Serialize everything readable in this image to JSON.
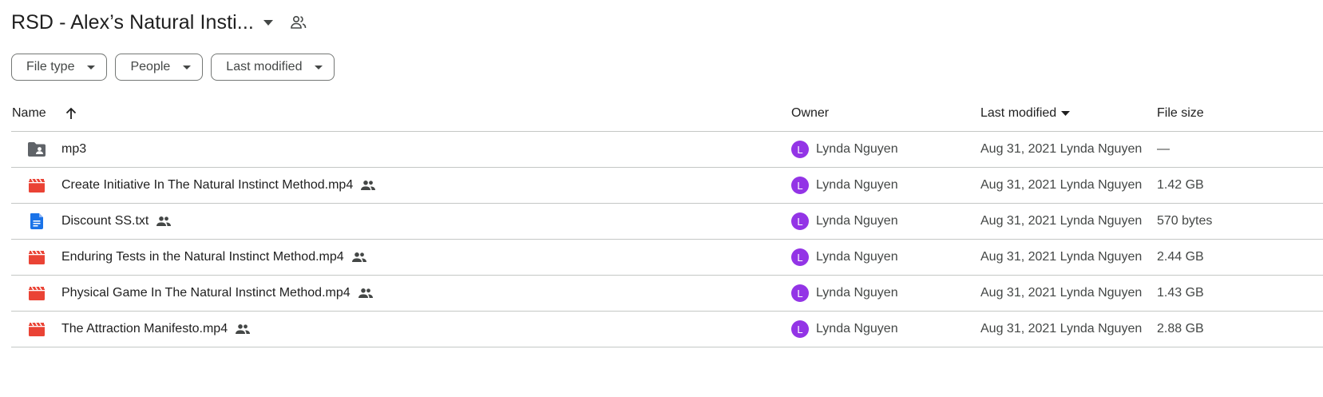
{
  "header": {
    "title": "RSD - Alex’s Natural Insti..."
  },
  "filters": {
    "file_type": "File type",
    "people": "People",
    "last_modified": "Last modified"
  },
  "columns": {
    "name": "Name",
    "owner": "Owner",
    "last_modified": "Last modified",
    "file_size": "File size"
  },
  "colors": {
    "video": "#ea4335",
    "doc": "#1a73e8",
    "folder": "#5f6368",
    "avatar": "#9334e6"
  },
  "rows": [
    {
      "icon": "shared-folder-icon",
      "name": "mp3",
      "owner": "Lynda Nguyen",
      "owner_initial": "L",
      "modified": "Aug 31, 2021 Lynda Nguyen",
      "size": "—"
    },
    {
      "icon": "video-file-icon",
      "name": "Create Initiative In The Natural Instinct Method.mp4",
      "owner": "Lynda Nguyen",
      "owner_initial": "L",
      "modified": "Aug 31, 2021 Lynda Nguyen",
      "size": "1.42 GB"
    },
    {
      "icon": "text-file-icon",
      "name": "Discount SS.txt",
      "owner": "Lynda Nguyen",
      "owner_initial": "L",
      "modified": "Aug 31, 2021 Lynda Nguyen",
      "size": "570 bytes"
    },
    {
      "icon": "video-file-icon",
      "name": "Enduring Tests in the Natural Instinct Method.mp4",
      "owner": "Lynda Nguyen",
      "owner_initial": "L",
      "modified": "Aug 31, 2021 Lynda Nguyen",
      "size": "2.44 GB"
    },
    {
      "icon": "video-file-icon",
      "name": "Physical Game In The Natural Instinct Method.mp4",
      "owner": "Lynda Nguyen",
      "owner_initial": "L",
      "modified": "Aug 31, 2021 Lynda Nguyen",
      "size": "1.43 GB"
    },
    {
      "icon": "video-file-icon",
      "name": "The Attraction Manifesto.mp4",
      "owner": "Lynda Nguyen",
      "owner_initial": "L",
      "modified": "Aug 31, 2021 Lynda Nguyen",
      "size": "2.88 GB"
    }
  ]
}
